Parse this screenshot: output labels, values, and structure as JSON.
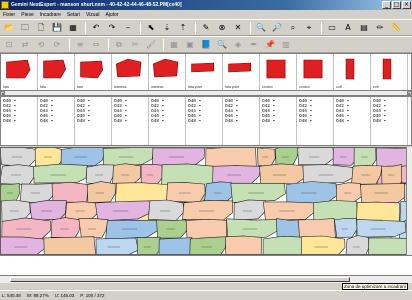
{
  "window": {
    "title": "Gemini NestExpert - manson shurt.nxm - 40-42-42-44-46-48-52.PM[cx40]",
    "minimize": "_",
    "maximize": "□",
    "close": "×"
  },
  "menu": [
    "Fisier",
    "Piese",
    "Incadrare",
    "Setari",
    "Vizual",
    "Ajutor"
  ],
  "toolbar1": [
    {
      "name": "open-icon",
      "glyph": "📂"
    },
    {
      "name": "folder-icon",
      "glyph": "🗀"
    },
    {
      "name": "page-icon",
      "glyph": "🗋"
    },
    {
      "name": "save-icon",
      "glyph": "💾"
    },
    {
      "name": "grid-icon",
      "glyph": "▦"
    },
    {
      "name": "sep"
    },
    {
      "name": "undo-icon",
      "glyph": "↶"
    },
    {
      "name": "redo-icon",
      "glyph": "↷"
    },
    {
      "name": "dash-icon",
      "glyph": "–"
    },
    {
      "name": "sep"
    },
    {
      "name": "cursor-icon",
      "glyph": "⬉"
    },
    {
      "name": "arrow-down-icon",
      "glyph": "⇣"
    },
    {
      "name": "arrow-up-icon",
      "glyph": "⇡"
    },
    {
      "name": "sep"
    },
    {
      "name": "wand-icon",
      "glyph": "✎"
    },
    {
      "name": "stop-icon",
      "glyph": "⊗"
    },
    {
      "name": "close-red-icon",
      "glyph": "✕"
    },
    {
      "name": "sep"
    },
    {
      "name": "zoom-in-icon",
      "glyph": "🔍"
    },
    {
      "name": "zoom-out-icon",
      "glyph": "🔎"
    },
    {
      "name": "zoom-fit-icon",
      "glyph": "⌕"
    },
    {
      "name": "zoom-window-icon",
      "glyph": "⌖"
    },
    {
      "name": "sep"
    },
    {
      "name": "folder-yellow-icon",
      "glyph": "▭"
    },
    {
      "name": "text-icon",
      "glyph": "A"
    },
    {
      "name": "note-icon",
      "glyph": "▤"
    },
    {
      "name": "pencil-icon",
      "glyph": "✏"
    },
    {
      "name": "ruler-icon",
      "glyph": "📏"
    }
  ],
  "toolbar2": [
    {
      "name": "nest-icon",
      "glyph": "⊡"
    },
    {
      "name": "flip-icon",
      "glyph": "⇄"
    },
    {
      "name": "rotate-left-icon",
      "glyph": "⟲"
    },
    {
      "name": "rotate-right-icon",
      "glyph": "⟳"
    },
    {
      "name": "sep"
    },
    {
      "name": "align-icon",
      "glyph": "≡"
    },
    {
      "name": "spacing-icon",
      "glyph": "⇔"
    },
    {
      "name": "sep"
    },
    {
      "name": "group-icon",
      "glyph": "⧉"
    },
    {
      "name": "cut-icon",
      "glyph": "✂"
    },
    {
      "name": "brush-icon",
      "glyph": "🖌"
    },
    {
      "name": "sep"
    },
    {
      "name": "table-icon",
      "glyph": "▦"
    },
    {
      "name": "pieces-icon",
      "glyph": "▣"
    },
    {
      "name": "book-icon",
      "glyph": "📘"
    },
    {
      "name": "search-icon",
      "glyph": "🔍"
    },
    {
      "name": "layers-icon",
      "glyph": "◈"
    },
    {
      "name": "marker-icon",
      "glyph": "✒"
    },
    {
      "name": "pin-icon",
      "glyph": "📌"
    },
    {
      "name": "chart-icon",
      "glyph": "▥"
    }
  ],
  "pieces": [
    "fata",
    "fata",
    "fata",
    "maneca",
    "maneca",
    "fata yoke",
    "fata yoke",
    "cordon",
    "cordon",
    "cuff",
    "cuff"
  ],
  "size_columns": [
    [
      "O40",
      "O42",
      "O44",
      "O46",
      "O48"
    ],
    [
      "O40",
      "O42",
      "O44",
      "O46",
      "O48"
    ],
    [
      "O40",
      "O42",
      "O44",
      "O46",
      "O48"
    ],
    [
      "O40",
      "O42",
      "O44",
      "O46",
      "O48"
    ],
    [
      "O40",
      "O42",
      "O44",
      "O46",
      "O48"
    ],
    [
      "O40",
      "O42",
      "O44",
      "O46",
      "O48"
    ],
    [
      "O40",
      "O42",
      "O44",
      "O46",
      "O48"
    ],
    [
      "O40",
      "O42",
      "O44",
      "O46",
      "O48"
    ],
    [
      "O40",
      "O42",
      "O44",
      "O46",
      "O48"
    ],
    [
      "O40",
      "O42",
      "O44",
      "O46",
      "O48"
    ],
    [
      "O40",
      "O42",
      "O44",
      "O46",
      "O48"
    ]
  ],
  "zone_label": "Zona de optimizare a incadrarii",
  "status": [
    "L: 540.48",
    "W: 98.27%",
    "U: 145.03",
    "P: 100 / 372"
  ],
  "colors": {
    "piece_red": "#e02020",
    "layout_fills": [
      "#f2c9a0",
      "#a9d08e",
      "#9dc3e6",
      "#f4b6c2",
      "#d9d9d9",
      "#ffe699",
      "#c5e0b4",
      "#bdd7ee",
      "#e2b4e0",
      "#f8cbad"
    ]
  }
}
